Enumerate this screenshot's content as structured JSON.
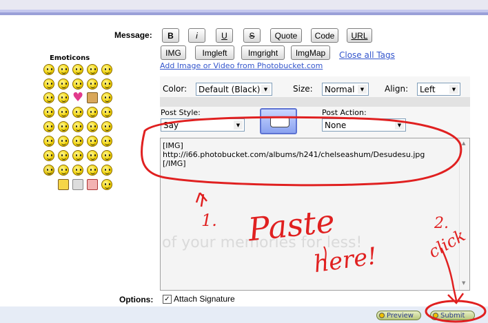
{
  "message_label": "Message:",
  "toolbar": {
    "row1": [
      "B",
      "i",
      "U",
      "S",
      "Quote",
      "Code",
      "URL"
    ],
    "row2": [
      "IMG",
      "Imgleft",
      "Imgright",
      "ImgMap"
    ],
    "close_all_tags": "Close all Tags",
    "add_media_link": "Add Image or Video from Photobucket.com"
  },
  "emoticons": {
    "title": "Emoticons"
  },
  "formatting": {
    "color_label": "Color:",
    "color_value": "Default (Black)",
    "size_label": "Size:",
    "size_value": "Normal",
    "align_label": "Align:",
    "align_value": "Left"
  },
  "post_style": {
    "label": "Post Style:",
    "value": "Say"
  },
  "post_action": {
    "label": "Post Action:",
    "value": "None"
  },
  "message_body": "[IMG]\nhttp://i66.photobucket.com/albums/h241/chelseashum/Desudesu.jpg\n[/IMG]",
  "options": {
    "label": "Options:",
    "attach_signature": "Attach Signature",
    "checked": true
  },
  "buttons": {
    "preview": "Preview",
    "submit": "Submit"
  },
  "watermark": "of your memories for less!",
  "annotations": {
    "step1": "1.",
    "paste": "Paste",
    "here": "here!",
    "step2": "2.",
    "click": "click"
  },
  "colors": {
    "annotation": "#e02020",
    "link": "#3355cc",
    "top_band": "#9aa0d8"
  }
}
